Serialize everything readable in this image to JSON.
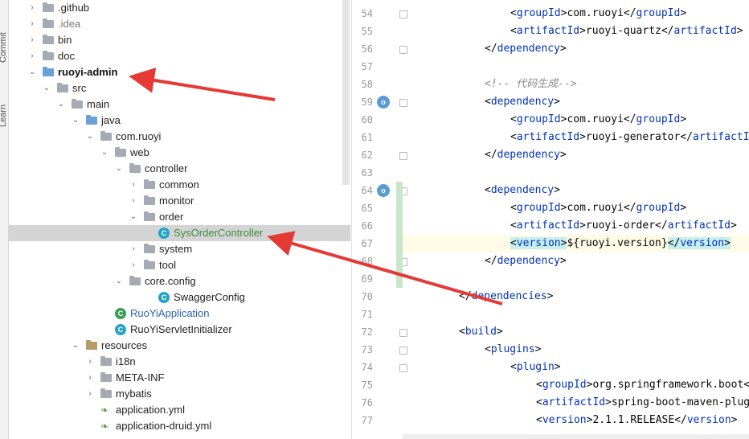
{
  "side_tabs": [
    "Commit",
    "Learn"
  ],
  "tree": [
    {
      "label": ".github",
      "kind": "folder",
      "style": "normal",
      "arrow": "right"
    },
    {
      "label": ".idea",
      "kind": "folder",
      "style": "dim",
      "arrow": "right"
    },
    {
      "label": "bin",
      "kind": "folder",
      "style": "normal",
      "arrow": "right"
    },
    {
      "label": "doc",
      "kind": "folder",
      "style": "normal",
      "arrow": "right"
    },
    {
      "label": "ruoyi-admin",
      "kind": "module",
      "style": "bold",
      "arrow": "down"
    },
    {
      "label": "src",
      "kind": "folder",
      "style": "normal",
      "arrow": "down"
    },
    {
      "label": "main",
      "kind": "folder",
      "style": "normal",
      "arrow": "down"
    },
    {
      "label": "java",
      "kind": "source",
      "style": "normal",
      "arrow": "down"
    },
    {
      "label": "com.ruoyi",
      "kind": "package",
      "style": "normal",
      "arrow": "down"
    },
    {
      "label": "web",
      "kind": "package",
      "style": "normal",
      "arrow": "down"
    },
    {
      "label": "controller",
      "kind": "package",
      "style": "normal",
      "arrow": "down"
    },
    {
      "label": "common",
      "kind": "package",
      "style": "normal",
      "arrow": "right"
    },
    {
      "label": "monitor",
      "kind": "package",
      "style": "normal",
      "arrow": "right"
    },
    {
      "label": "order",
      "kind": "package",
      "style": "normal",
      "arrow": "down"
    },
    {
      "label": "SysOrderController",
      "kind": "class",
      "style": "green",
      "arrow": "none",
      "selected": true
    },
    {
      "label": "system",
      "kind": "package",
      "style": "normal",
      "arrow": "right"
    },
    {
      "label": "tool",
      "kind": "package",
      "style": "normal",
      "arrow": "right"
    },
    {
      "label": "core.config",
      "kind": "package",
      "style": "normal",
      "arrow": "down"
    },
    {
      "label": "SwaggerConfig",
      "kind": "class",
      "style": "normal",
      "arrow": "none"
    },
    {
      "label": "RuoYiApplication",
      "kind": "app",
      "style": "blue",
      "arrow": "none"
    },
    {
      "label": "RuoYiServletInitializer",
      "kind": "class",
      "style": "normal",
      "arrow": "none"
    },
    {
      "label": "resources",
      "kind": "resources",
      "style": "normal",
      "arrow": "down"
    },
    {
      "label": "i18n",
      "kind": "folder",
      "style": "normal",
      "arrow": "right"
    },
    {
      "label": "META-INF",
      "kind": "folder",
      "style": "normal",
      "arrow": "right"
    },
    {
      "label": "mybatis",
      "kind": "folder",
      "style": "normal",
      "arrow": "right"
    },
    {
      "label": "application.yml",
      "kind": "yml",
      "style": "normal",
      "arrow": "none"
    },
    {
      "label": "application-druid.yml",
      "kind": "yml",
      "style": "normal",
      "arrow": "none"
    }
  ],
  "editor": {
    "lines": [
      {
        "no": "54",
        "text": "<groupId>com.ruoyi</groupId>"
      },
      {
        "no": "55",
        "text": "<artifactId>ruoyi-quartz</artifactId>"
      },
      {
        "no": "56",
        "text": "</dependency>"
      },
      {
        "no": "57",
        "text": ""
      },
      {
        "no": "58",
        "text": "<!-- 代码生成-->"
      },
      {
        "no": "59",
        "text": "<dependency>"
      },
      {
        "no": "60",
        "text": "<groupId>com.ruoyi</groupId>"
      },
      {
        "no": "61",
        "text": "<artifactId>ruoyi-generator</artifactId>"
      },
      {
        "no": "62",
        "text": "</dependency>"
      },
      {
        "no": "63",
        "text": ""
      },
      {
        "no": "64",
        "text": "<dependency>"
      },
      {
        "no": "65",
        "text": "<groupId>com.ruoyi</groupId>"
      },
      {
        "no": "66",
        "text": "<artifactId>ruoyi-order</artifactId>"
      },
      {
        "no": "67",
        "text": "<version>${ruoyi.version}</version>"
      },
      {
        "no": "68",
        "text": "</dependency>"
      },
      {
        "no": "69",
        "text": ""
      },
      {
        "no": "70",
        "text": "</dependencies>"
      },
      {
        "no": "71",
        "text": ""
      },
      {
        "no": "72",
        "text": "<build>"
      },
      {
        "no": "73",
        "text": "<plugins>"
      },
      {
        "no": "74",
        "text": "<plugin>"
      },
      {
        "no": "75",
        "text": "<groupId>org.springframework.boot</gr"
      },
      {
        "no": "76",
        "text": "<artifactId>spring-boot-maven-plugin<"
      },
      {
        "no": "77",
        "text": "<version>2.1.1.RELEASE</version>"
      }
    ]
  },
  "colors": {
    "selection": "#d4d4d4",
    "tag": "#0033b3",
    "comment": "#8c8c8c",
    "annotation_arrow": "#e53935",
    "current_line": "#fffbe6"
  }
}
